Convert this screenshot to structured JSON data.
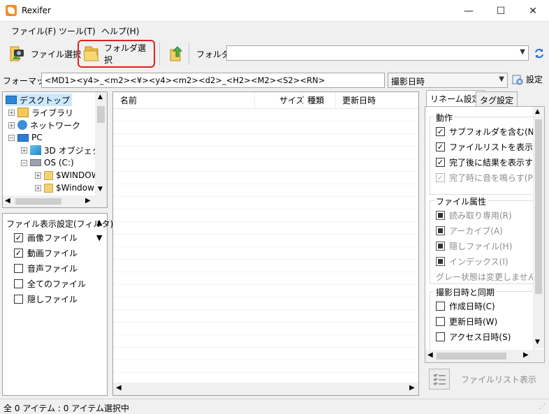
{
  "window": {
    "title": "Rexifer",
    "minimize": "—",
    "maximize": "☐",
    "close": "✕"
  },
  "menu": [
    "ファイル(F)",
    "ツール(T)",
    "ヘルプ(H)"
  ],
  "toolbar": {
    "file_select": "ファイル選択",
    "folder_select": "フォルダ選択",
    "folder_label": "フォルダ",
    "folder_value": ""
  },
  "format": {
    "label": "フォーマット",
    "value": "<MD1><y4>_<m2><¥><y4><m2><d2>_<H2><M2><S2><RN>",
    "date_source": "撮影日時",
    "settings": "設定"
  },
  "tree": {
    "items": [
      "デスクトップ",
      "ライブラリ",
      "ネットワーク",
      "PC",
      "3D オブジェクト",
      "OS (C:)",
      "$WINDOW",
      "$Window"
    ]
  },
  "filter": {
    "title": "ファイル表示設定(フィルタ)",
    "items": [
      {
        "label": "画像ファイル",
        "checked": true
      },
      {
        "label": "動画ファイル",
        "checked": true
      },
      {
        "label": "音声ファイル",
        "checked": false
      },
      {
        "label": "全てのファイル",
        "checked": false
      },
      {
        "label": "隠しファイル",
        "checked": false
      }
    ]
  },
  "filelist": {
    "columns": [
      "名前",
      "サイズ",
      "種類",
      "更新日時"
    ]
  },
  "settings_panel": {
    "tabs": [
      "リネーム設定",
      "タグ設定"
    ],
    "action": {
      "title": "動作",
      "items": [
        {
          "label": "サブフォルダを含む(N)",
          "checked": true
        },
        {
          "label": "ファイルリストを表示する(F",
          "checked": true
        },
        {
          "label": "完了後に結果を表示する",
          "checked": true
        },
        {
          "label": "完了時に音を鳴らす(P)",
          "checked": true,
          "disabled": true
        }
      ]
    },
    "attributes": {
      "title": "ファイル属性",
      "items": [
        "読み取り専用(R)",
        "アーカイブ(A)",
        "隠しファイル(H)",
        "インデックス(I)"
      ],
      "note": "グレー状態は変更しません。"
    },
    "sync": {
      "title": "撮影日時と同期",
      "items": [
        "作成日時(C)",
        "更新日時(W)",
        "アクセス日時(S)"
      ]
    },
    "filelist_button": "ファイルリスト表示"
  },
  "status": {
    "text": "全 0 アイテム : 0 アイテム選択中"
  }
}
